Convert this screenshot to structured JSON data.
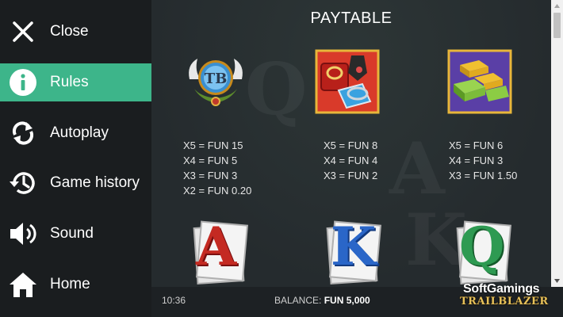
{
  "menu": {
    "items": [
      {
        "label": "Close",
        "icon": "close-icon"
      },
      {
        "label": "Rules",
        "icon": "info-icon",
        "active": true
      },
      {
        "label": "Autoplay",
        "icon": "autoplay-icon"
      },
      {
        "label": "Game history",
        "icon": "history-icon"
      },
      {
        "label": "Sound",
        "icon": "sound-icon"
      },
      {
        "label": "Home",
        "icon": "home-icon"
      }
    ]
  },
  "paytable": {
    "title": "PAYTABLE",
    "symbols": [
      {
        "name": "logo-symbol",
        "pays": [
          "X5 = FUN 15",
          "X4 = FUN 5",
          "X3 = FUN 3",
          "X2 = FUN 0.20"
        ]
      },
      {
        "name": "jewelry-symbol",
        "pays": [
          "X5 = FUN 8",
          "X4 = FUN 4",
          "X3 = FUN 2"
        ]
      },
      {
        "name": "gold-money-symbol",
        "pays": [
          "X5 = FUN 6",
          "X4 = FUN 3",
          "X3 = FUN 1.50"
        ]
      },
      {
        "name": "a-symbol",
        "letter": "A"
      },
      {
        "name": "k-symbol",
        "letter": "K"
      },
      {
        "name": "q-symbol",
        "letter": "Q"
      }
    ]
  },
  "footer": {
    "time": "10:36",
    "balance_label": "BALANCE:",
    "balance_value": "FUN 5,000"
  },
  "branding": {
    "brand": "SoftGamings",
    "game": "TRAILBLAZER"
  },
  "colors": {
    "accent": "#3db58a",
    "sidebar": "#1a1d1f",
    "background": "#252b2e"
  }
}
